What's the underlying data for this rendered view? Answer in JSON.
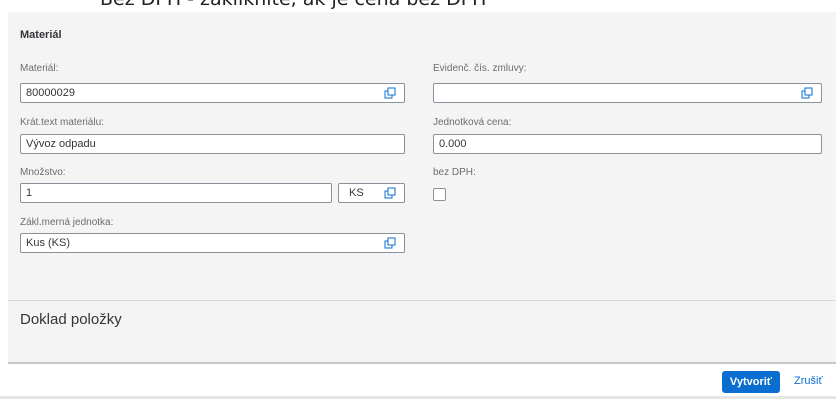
{
  "top_note": "Bez DPH - zakliknite, ak je cena bez DPH",
  "section": {
    "title": "Materiál"
  },
  "fields": {
    "material": {
      "label": "Materiál:",
      "value": "80000029"
    },
    "contract": {
      "label": "Evidenč. čís. zmluvy:",
      "value": ""
    },
    "short_text": {
      "label": "Krát.text materiálu:",
      "value": "Vývoz odpadu"
    },
    "unit_price": {
      "label": "Jednotková cena:",
      "value": "0.000"
    },
    "quantity": {
      "label": "Množstvo:",
      "value": "1",
      "unit": "KS"
    },
    "vat": {
      "label": "bez DPH:",
      "checked": false
    },
    "base_unit": {
      "label": "Zákl.merná jednotka:",
      "value": "Kus (KS)"
    }
  },
  "document": {
    "title": "Doklad položky"
  },
  "footer": {
    "create_label": "Vytvoriť",
    "cancel_label": "Zrušiť"
  },
  "colors": {
    "accent": "#0a6ed1",
    "panel_bg": "#f4f4f4"
  },
  "icons": {
    "value_help": "value-help-icon"
  }
}
